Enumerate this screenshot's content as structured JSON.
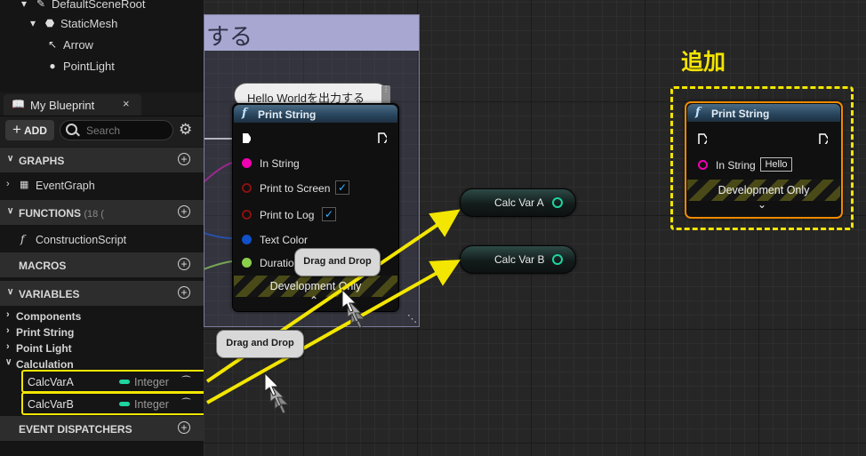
{
  "components": [
    {
      "label": "DefaultSceneRoot",
      "icon": "scene-root-icon"
    },
    {
      "label": "StaticMesh",
      "icon": "static-mesh-icon"
    },
    {
      "label": "Arrow",
      "icon": "arrow-component-icon"
    },
    {
      "label": "PointLight",
      "icon": "point-light-icon"
    }
  ],
  "tab": {
    "label": "My Blueprint",
    "close": "×"
  },
  "toolbar": {
    "add_label": "ADD",
    "search_placeholder": "Search"
  },
  "sections": {
    "graphs": "GRAPHS",
    "functions": "FUNCTIONS",
    "functions_count": "(18 (",
    "macros": "MACROS",
    "variables": "VARIABLES",
    "event_dispatchers": "EVENT DISPATCHERS"
  },
  "graph_items": [
    "EventGraph"
  ],
  "function_items": [
    "ConstructionScript"
  ],
  "variable_categories": [
    "Components",
    "Print String",
    "Point Light",
    "Calculation"
  ],
  "variables": [
    {
      "name": "CalcVarA",
      "type": "Integer"
    },
    {
      "name": "CalcVarB",
      "type": "Integer"
    }
  ],
  "graph": {
    "comment_title": "する",
    "comment_bubble": "Hello Worldを出力する",
    "print_node": {
      "title": "Print String",
      "pins": [
        "In String",
        "Print to Screen",
        "Print to Log",
        "Text Color",
        "Duration"
      ],
      "footer": "Development Only"
    },
    "get_nodes": [
      "Calc Var A",
      "Calc Var B"
    ],
    "drag_tooltips": [
      "Drag and Drop",
      "Drag and Drop"
    ],
    "added_label": "追加",
    "added_node": {
      "title": "Print String",
      "pin": "In String",
      "pin_value": "Hello",
      "footer": "Development Only"
    },
    "colors": {
      "highlight": "#f3e600",
      "integer_pin": "#1ed4a0",
      "string_pin": "#f000b0",
      "selected_border": "#f08a00"
    }
  }
}
